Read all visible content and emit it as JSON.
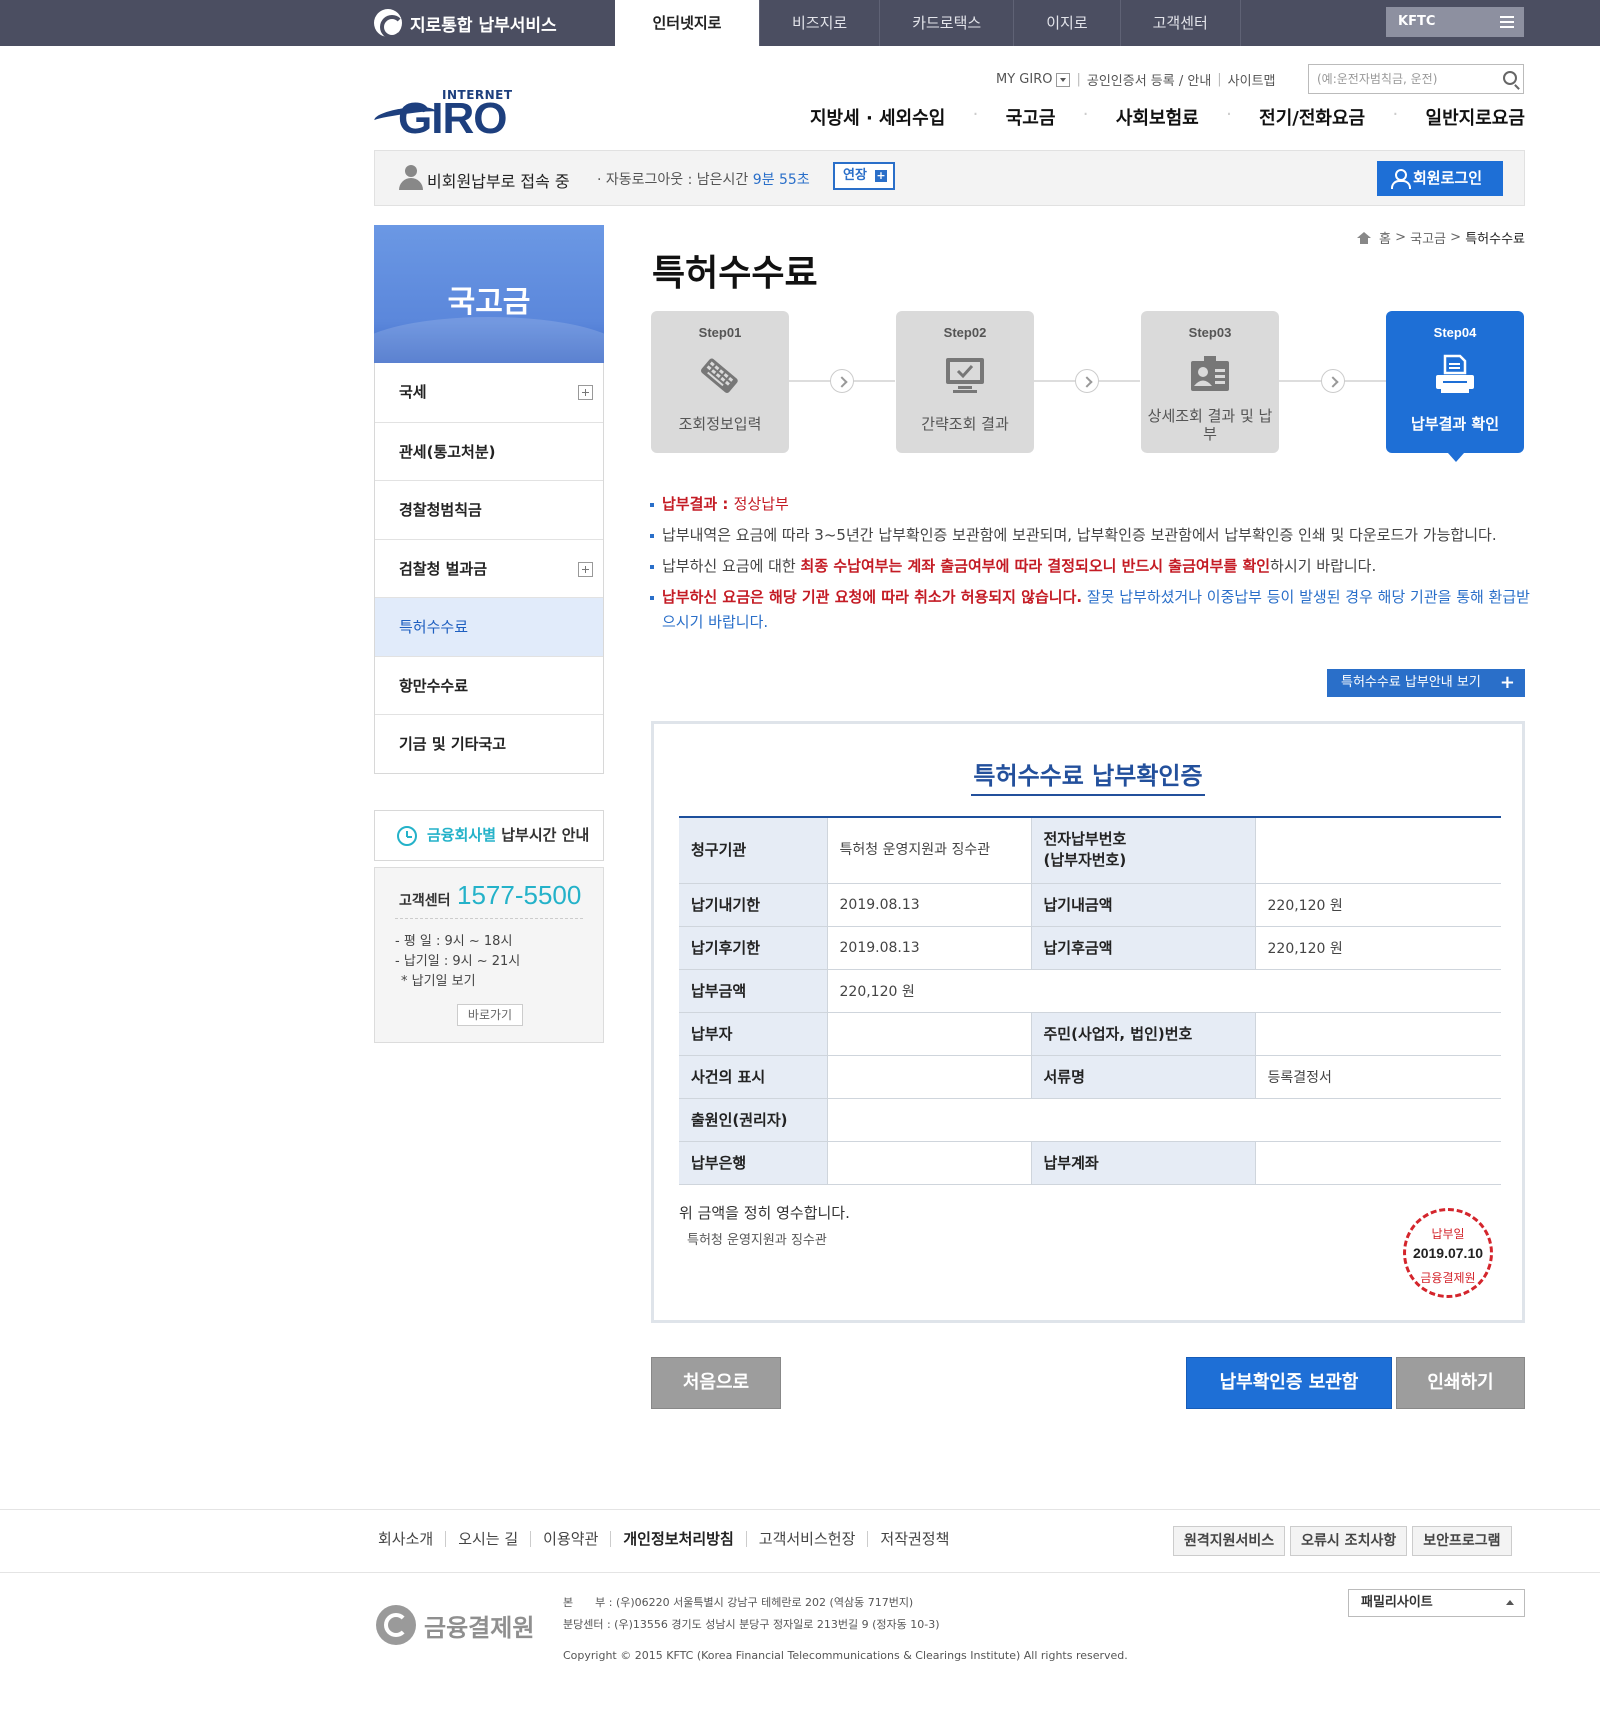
{
  "top_bar": {
    "brand": "지로통합 납부서비스",
    "tabs": [
      "인터넷지로",
      "비즈지로",
      "카드로택스",
      "이지로",
      "고객센터"
    ],
    "active_tab_index": 0,
    "kftc": "KFTC"
  },
  "header": {
    "logo_small": "INTERNET",
    "logo_big": "GIRO",
    "util": {
      "my_giro": "MY GIRO",
      "cert": "공인인증서 등록 / 안내",
      "sitemap": "사이트맵"
    },
    "search_placeholder": "(예:운전자범칙금, 운전)",
    "main_nav": [
      "지방세 · 세외수입",
      "국고금",
      "사회보험료",
      "전기/전화요금",
      "일반지로요금"
    ]
  },
  "session": {
    "status": "비회원납부로 접속 중",
    "auto_logout_label": "· 자동로그아웃 : 남은시간",
    "remaining": "9분 55초",
    "extend": "연장",
    "login": "회원로그인"
  },
  "sidebar": {
    "title": "국고금",
    "items": [
      {
        "label": "국세",
        "expandable": true
      },
      {
        "label": "관세(통고처분)",
        "expandable": false
      },
      {
        "label": "경찰청범칙금",
        "expandable": false
      },
      {
        "label": "검찰청 벌과금",
        "expandable": true
      },
      {
        "label": "특허수수료",
        "expandable": false,
        "active": true
      },
      {
        "label": "항만수수료",
        "expandable": false
      },
      {
        "label": "기금 및 기타국고",
        "expandable": false
      }
    ],
    "time_guide_hl": "금융회사별",
    "time_guide_rest": "납부시간 안내",
    "cs_label": "고객센터",
    "cs_phone": "1577-5500",
    "hours": [
      "- 평 일 : 9시 ~ 18시",
      "- 납기일 : 9시 ~ 21시",
      "* 납기일 보기"
    ],
    "go": "바로가기"
  },
  "breadcrumb": {
    "home": "홈",
    "sep": ">",
    "level1": "국고금",
    "current": "특허수수료"
  },
  "page_title": "특허수수료",
  "steps": [
    {
      "label": "Step01",
      "name": "조회정보입력",
      "icon": "keyboard-icon"
    },
    {
      "label": "Step02",
      "name": "간략조회 결과",
      "icon": "monitor-check-icon"
    },
    {
      "label": "Step03",
      "name": "상세조회 결과 및 납부",
      "icon": "id-card-icon"
    },
    {
      "label": "Step04",
      "name": "납부결과 확인",
      "icon": "printer-icon",
      "active": true
    }
  ],
  "notices": {
    "n1_label": "납부결과 : ",
    "n1_value": "정상납부",
    "n2": "납부내역은 요금에 따라 3~5년간 납부확인증 보관함에 보관되며, 납부확인증 보관함에서 납부확인증 인쇄 및 다운로드가 가능합니다.",
    "n3_a": "납부하신 요금에 대한 ",
    "n3_b": "최종 수납여부는 계좌 출금여부에 따라 결정되오니 반드시 출금여부를 확인",
    "n3_c": "하시기 바랍니다.",
    "n4_a": "납부하신 요금은 해당 기관 요청에 따라 취소가 허용되지 않습니다.",
    "n4_b": " 잘못 납부하셨거나 이중납부 등이 발생된 경우 해당 기관을 통해 환급받으시기 바랍니다."
  },
  "guide_button": "특허수수료 납부안내 보기",
  "receipt": {
    "title": "특허수수료 납부확인증",
    "rows": {
      "org_label": "청구기관",
      "org_value": "특허청 운영지원과 징수관",
      "epay_label_1": "전자납부번호",
      "epay_label_2": "(납부자번호)",
      "epay_value": "",
      "due_label": "납기내기한",
      "due_value": "2019.08.13",
      "due_amt_label": "납기내금액",
      "due_amt_value": "220,120 원",
      "after_label": "납기후기한",
      "after_value": "2019.08.13",
      "after_amt_label": "납기후금액",
      "after_amt_value": "220,120 원",
      "paid_label": "납부금액",
      "paid_value": "220,120 원",
      "payer_label": "납부자",
      "payer_value": "",
      "id_label": "주민(사업자, 법인)번호",
      "id_value": "",
      "case_label": "사건의 표시",
      "case_value": "",
      "doc_label": "서류명",
      "doc_value": "등록결정서",
      "applicant_label": "출원인(권리자)",
      "applicant_value": "",
      "bank_label": "납부은행",
      "bank_value": "",
      "account_label": "납부계좌",
      "account_value": ""
    },
    "note": "위 금액을 정히 영수합니다.",
    "org": "특허청 운영지원과 징수관",
    "stamp": {
      "top": "납부일",
      "date": "2019.07.10",
      "bottom": "금융결제원"
    }
  },
  "actions": {
    "first": "처음으로",
    "box": "납부확인증 보관함",
    "print": "인쇄하기"
  },
  "footer": {
    "links": [
      "회사소개",
      "오시는 길",
      "이용약관",
      "개인정보처리방침",
      "고객서비스헌장",
      "저작권정책"
    ],
    "bold_link_index": 3,
    "buttons": [
      "원격지원서비스",
      "오류시 조치사항",
      "보안프로그램"
    ],
    "logo": "금융결제원",
    "address_main": "본　　부 : (우)06220 서울특별시 강남구 테헤란로 202 (역삼동 717번지)",
    "address_branch": "분당센터 : (우)13556 경기도 성남시 분당구 정자일로 213번길 9 (정자동 10-3)",
    "copyright": "Copyright © 2015 KFTC (Korea Financial Telecommunications & Clearings Institute) All rights reserved.",
    "family": "패밀리사이트"
  }
}
